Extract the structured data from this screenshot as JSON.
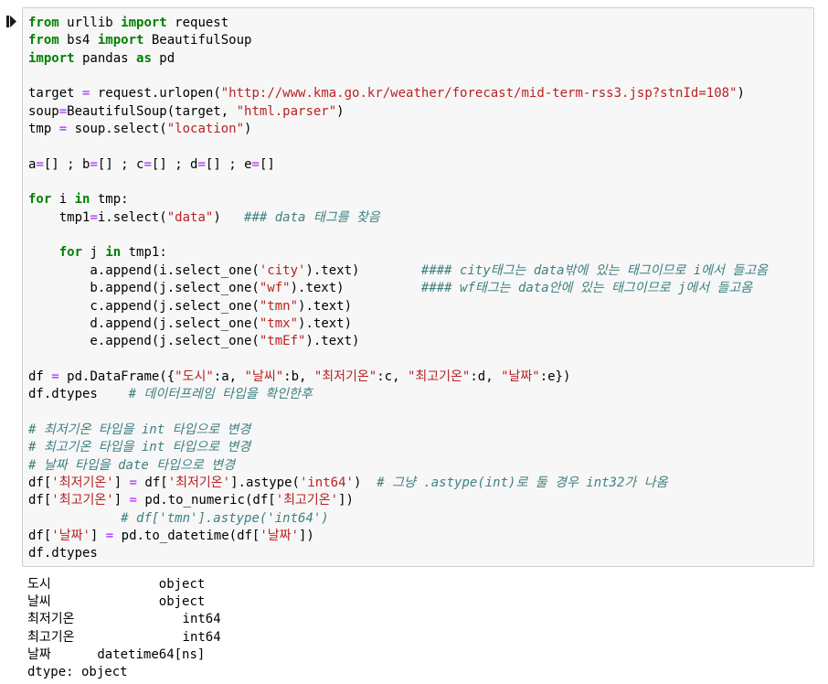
{
  "cell": {
    "code_lines": [
      [
        {
          "t": "from",
          "c": "kw"
        },
        {
          "t": " urllib "
        },
        {
          "t": "import",
          "c": "kw"
        },
        {
          "t": " request"
        }
      ],
      [
        {
          "t": "from",
          "c": "kw"
        },
        {
          "t": " bs4 "
        },
        {
          "t": "import",
          "c": "kw"
        },
        {
          "t": " BeautifulSoup"
        }
      ],
      [
        {
          "t": "import",
          "c": "kw"
        },
        {
          "t": " pandas "
        },
        {
          "t": "as",
          "c": "kw"
        },
        {
          "t": " pd"
        }
      ],
      [],
      [
        {
          "t": "target "
        },
        {
          "t": "=",
          "c": "op"
        },
        {
          "t": " request.urlopen("
        },
        {
          "t": "\"http://www.kma.go.kr/weather/forecast/mid-term-rss3.jsp?stnId=108\"",
          "c": "str"
        },
        {
          "t": ")"
        }
      ],
      [
        {
          "t": "soup"
        },
        {
          "t": "=",
          "c": "op"
        },
        {
          "t": "BeautifulSoup(target, "
        },
        {
          "t": "\"html.parser\"",
          "c": "str"
        },
        {
          "t": ")"
        }
      ],
      [
        {
          "t": "tmp "
        },
        {
          "t": "=",
          "c": "op"
        },
        {
          "t": " soup.select("
        },
        {
          "t": "\"location\"",
          "c": "str"
        },
        {
          "t": ")"
        }
      ],
      [],
      [
        {
          "t": "a"
        },
        {
          "t": "=",
          "c": "op"
        },
        {
          "t": "[] ; b"
        },
        {
          "t": "=",
          "c": "op"
        },
        {
          "t": "[] ; c"
        },
        {
          "t": "=",
          "c": "op"
        },
        {
          "t": "[] ; d"
        },
        {
          "t": "=",
          "c": "op"
        },
        {
          "t": "[] ; e"
        },
        {
          "t": "=",
          "c": "op"
        },
        {
          "t": "[]"
        }
      ],
      [],
      [
        {
          "t": "for",
          "c": "kw"
        },
        {
          "t": " i "
        },
        {
          "t": "in",
          "c": "kw"
        },
        {
          "t": " tmp:"
        }
      ],
      [
        {
          "t": "    tmp1"
        },
        {
          "t": "=",
          "c": "op"
        },
        {
          "t": "i.select("
        },
        {
          "t": "\"data\"",
          "c": "str"
        },
        {
          "t": ")   "
        },
        {
          "t": "### data 태그를 찾음",
          "c": "cm"
        }
      ],
      [],
      [
        {
          "t": "    "
        },
        {
          "t": "for",
          "c": "kw"
        },
        {
          "t": " j "
        },
        {
          "t": "in",
          "c": "kw"
        },
        {
          "t": " tmp1:"
        }
      ],
      [
        {
          "t": "        a.append(i.select_one("
        },
        {
          "t": "'city'",
          "c": "str"
        },
        {
          "t": ").text)        "
        },
        {
          "t": "#### city태그는 data밖에 있는 태그이므로 i에서 들고옴",
          "c": "cm"
        }
      ],
      [
        {
          "t": "        b.append(j.select_one("
        },
        {
          "t": "\"wf\"",
          "c": "str"
        },
        {
          "t": ").text)          "
        },
        {
          "t": "#### wf태그는 data안에 있는 태그이므로 j에서 들고옴",
          "c": "cm"
        }
      ],
      [
        {
          "t": "        c.append(j.select_one("
        },
        {
          "t": "\"tmn\"",
          "c": "str"
        },
        {
          "t": ").text)"
        }
      ],
      [
        {
          "t": "        d.append(j.select_one("
        },
        {
          "t": "\"tmx\"",
          "c": "str"
        },
        {
          "t": ").text)"
        }
      ],
      [
        {
          "t": "        e.append(j.select_one("
        },
        {
          "t": "\"tmEf\"",
          "c": "str"
        },
        {
          "t": ").text)"
        }
      ],
      [],
      [
        {
          "t": "df "
        },
        {
          "t": "=",
          "c": "op"
        },
        {
          "t": " pd.DataFrame({"
        },
        {
          "t": "\"도시\"",
          "c": "str"
        },
        {
          "t": ":a, "
        },
        {
          "t": "\"날씨\"",
          "c": "str"
        },
        {
          "t": ":b, "
        },
        {
          "t": "\"최저기온\"",
          "c": "str"
        },
        {
          "t": ":c, "
        },
        {
          "t": "\"최고기온\"",
          "c": "str"
        },
        {
          "t": ":d, "
        },
        {
          "t": "\"날짜\"",
          "c": "str"
        },
        {
          "t": ":e})"
        }
      ],
      [
        {
          "t": "df.dtypes    "
        },
        {
          "t": "# 데이터프레임 타입을 확인한후",
          "c": "cm"
        }
      ],
      [],
      [
        {
          "t": "# 최저기온 타입을 int 타입으로 변경",
          "c": "cm"
        }
      ],
      [
        {
          "t": "# 최고기온 타입을 int 타입으로 변경",
          "c": "cm"
        }
      ],
      [
        {
          "t": "# 날짜 타입을 date 타입으로 변경",
          "c": "cm"
        }
      ],
      [
        {
          "t": "df["
        },
        {
          "t": "'최저기온'",
          "c": "str"
        },
        {
          "t": "] "
        },
        {
          "t": "=",
          "c": "op"
        },
        {
          "t": " df["
        },
        {
          "t": "'최저기온'",
          "c": "str"
        },
        {
          "t": "].astype("
        },
        {
          "t": "'int64'",
          "c": "str"
        },
        {
          "t": ")  "
        },
        {
          "t": "# 그냥 .astype(int)로 둘 경우 int32가 나옴",
          "c": "cm"
        }
      ],
      [
        {
          "t": "df["
        },
        {
          "t": "'최고기온'",
          "c": "str"
        },
        {
          "t": "] "
        },
        {
          "t": "=",
          "c": "op"
        },
        {
          "t": " pd.to_numeric(df["
        },
        {
          "t": "'최고기온'",
          "c": "str"
        },
        {
          "t": "])"
        }
      ],
      [
        {
          "t": "            "
        },
        {
          "t": "# df['tmn'].astype('int64')",
          "c": "cm"
        }
      ],
      [
        {
          "t": "df["
        },
        {
          "t": "'날짜'",
          "c": "str"
        },
        {
          "t": "] "
        },
        {
          "t": "=",
          "c": "op"
        },
        {
          "t": " pd.to_datetime(df["
        },
        {
          "t": "'날짜'",
          "c": "str"
        },
        {
          "t": "])"
        }
      ],
      [
        {
          "t": "df.dtypes"
        }
      ]
    ]
  },
  "output": {
    "lines": [
      "도시              object",
      "날씨              object",
      "최저기온              int64",
      "최고기온              int64",
      "날짜      datetime64[ns]",
      "dtype: object"
    ]
  },
  "colors": {
    "keyword": "#008000",
    "string": "#ba2121",
    "comment": "#408080",
    "operator": "#aa22ff",
    "cell_bg": "#f7f7f7"
  },
  "icons": {
    "run": "run-cell-icon"
  }
}
